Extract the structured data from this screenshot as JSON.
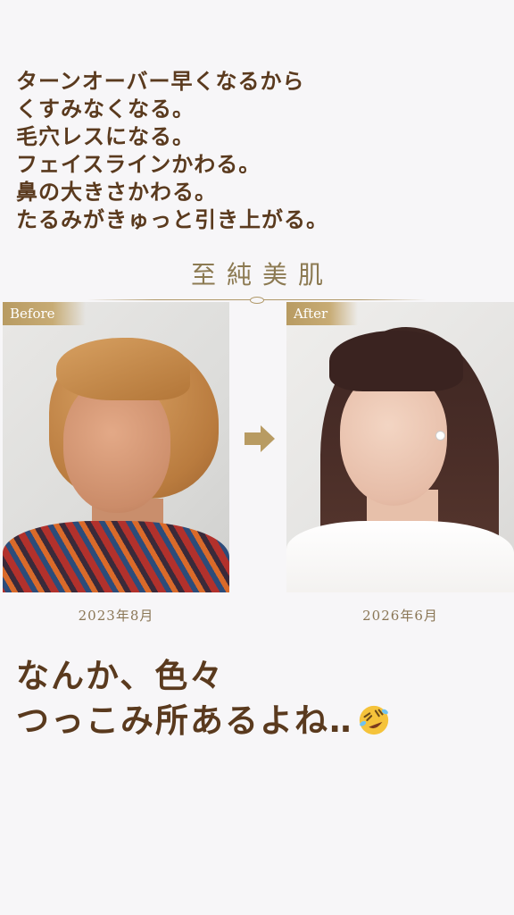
{
  "intro": {
    "lines": [
      "ターンオーバー早くなるから",
      "くすみなくなる。",
      "毛穴レスになる。",
      "フェイスラインかわる。",
      "鼻の大きさかわる。",
      "たるみがきゅっと引き上がる。"
    ]
  },
  "brand": {
    "title": "至純美肌"
  },
  "comparison": {
    "before": {
      "tag": "Before",
      "date": "2023年8月"
    },
    "after": {
      "tag": "After",
      "date": "2026年6月"
    },
    "arrow_icon": "arrow-right-icon",
    "accent_color": "#b89b62"
  },
  "caption": {
    "line1": "なんか、色々",
    "line2": "つっこみ所あるよね‥",
    "emoji_icon": "rolling-on-floor-laughing-icon"
  }
}
